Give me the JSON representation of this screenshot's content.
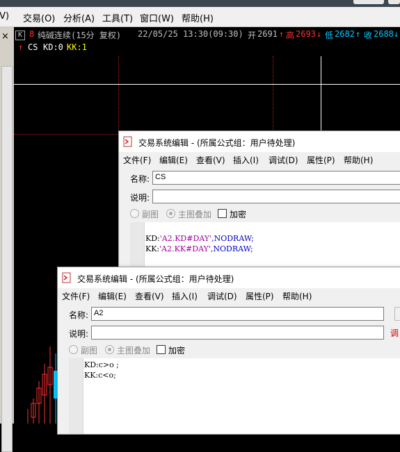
{
  "menu": [
    "(V)",
    "交易(O)",
    "分析(A)",
    "工具(T)",
    "窗口(W)",
    "帮助(H)"
  ],
  "left_strip": {
    "close": "×"
  },
  "chart_info": {
    "k_box": "K",
    "marker": "8",
    "symbol": "纯碱连续(15分 复权)",
    "datetime": "22/05/25 13:30(09:30)",
    "open_label": "开",
    "open": "2691",
    "high_label": "高",
    "high": "2693",
    "low_label": "低",
    "low": "2682",
    "close_label": "收",
    "close": "2688",
    "colors": {
      "up": "#ff3030",
      "down": "#00c8ff",
      "text": "#c0c0c0",
      "yellow": "#ffff00"
    }
  },
  "indicator_line": {
    "arrow": "↑",
    "name": "CS",
    "kd": "KD:0",
    "kk": "KK:1"
  },
  "dialog_back": {
    "title": "交易系统编辑 - (所属公式组：用户待处理)",
    "menu": [
      "文件(F)",
      "编辑(E)",
      "查看(V)",
      "插入(I)",
      "调试(D)",
      "属性(P)",
      "帮助(H)"
    ],
    "name_label": "名称:",
    "name_value": "CS",
    "desc_label": "说明:",
    "desc_value": "",
    "opt_sub": "副图",
    "opt_main": "主图叠加",
    "opt_encrypt": "加密",
    "code": [
      {
        "var": "KD:",
        "str": "'A2.KD#DAY'",
        "rest": ",NODRAW;"
      },
      {
        "var": "KK:",
        "str": "'A2.KK#DAY'",
        "rest": ",NODRAW;"
      }
    ]
  },
  "dialog_front": {
    "title": "交易系统编辑 - (所属公式组：用户待处理)",
    "menu": [
      "文件(F)",
      "编辑(E)",
      "查看(V)",
      "插入(I)",
      "调试(D)",
      "属性(P)",
      "帮助(H)"
    ],
    "name_label": "名称:",
    "name_value": "A2",
    "desc_label": "说明:",
    "desc_value": "",
    "right_hint": "调",
    "opt_sub": "副图",
    "opt_main": "主图叠加",
    "opt_encrypt": "加密",
    "code": [
      "KD:c>o ;",
      "KK:c<o;"
    ]
  }
}
